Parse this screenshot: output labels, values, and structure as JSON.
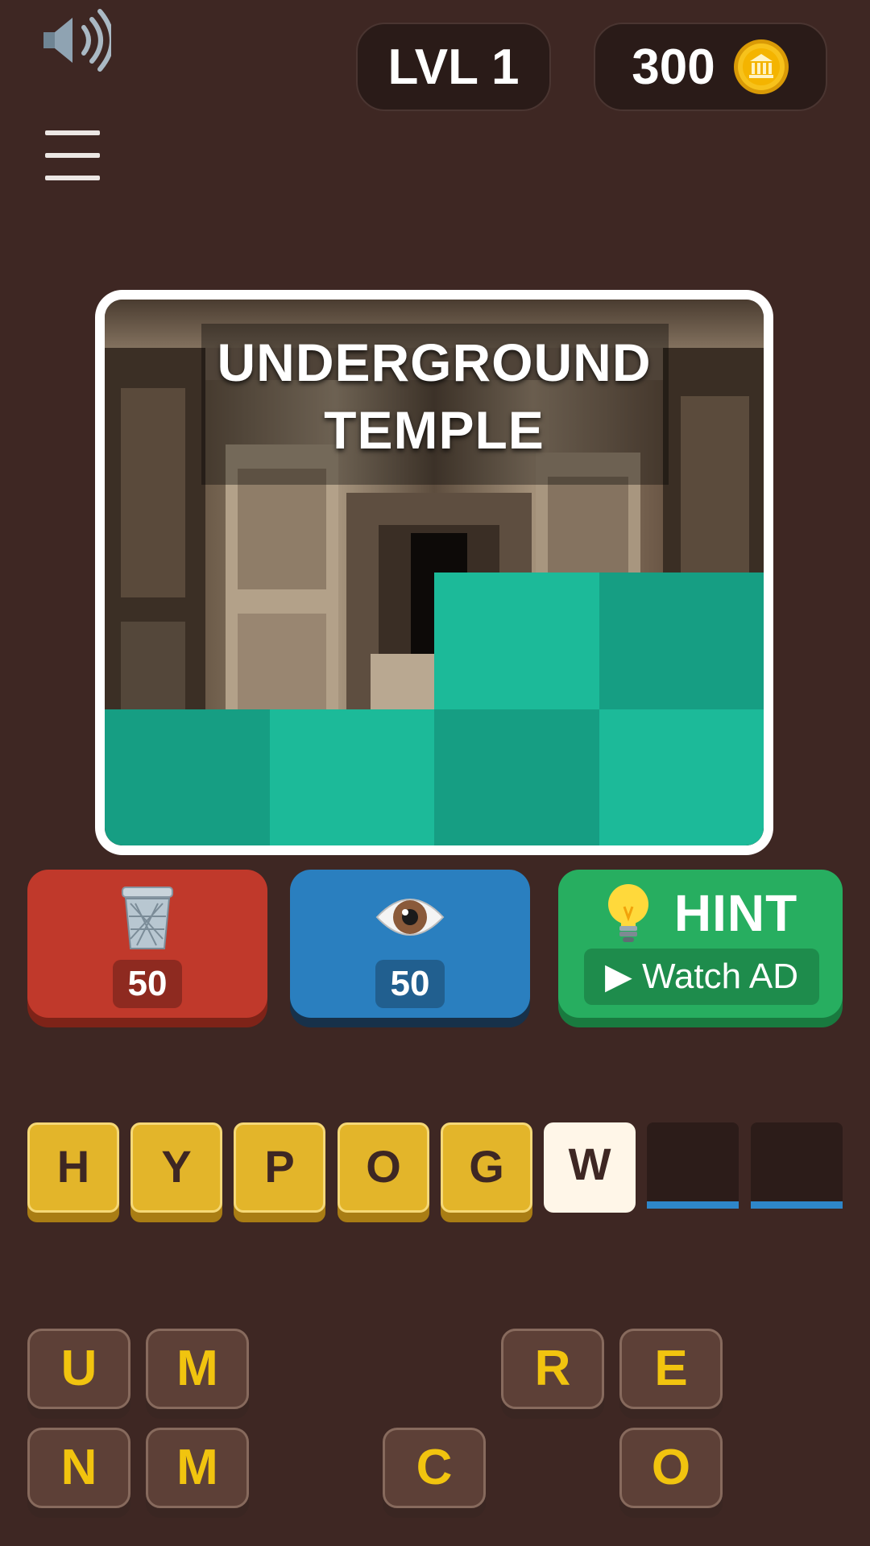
{
  "header": {
    "sound_icon": "speaker-icon",
    "menu_icon": "hamburger-menu-icon",
    "level_label": "LVL 1",
    "coins": "300",
    "coin_icon": "coin-icon"
  },
  "puzzle": {
    "caption_line1": "UNDERGROUND",
    "caption_line2": "TEMPLE",
    "covered_tiles": 6,
    "total_tiles": 12,
    "tile_colors": {
      "light": "#1cba99",
      "dark": "#169e83"
    }
  },
  "powerups": {
    "delete": {
      "icon": "trash-can-icon",
      "cost": "50",
      "color": "#c0392b"
    },
    "reveal": {
      "icon": "eye-icon",
      "cost": "50",
      "color": "#2a7fbf"
    },
    "hint": {
      "icon": "light-bulb-icon",
      "label": "HINT",
      "watch_ad": "▶ Watch AD",
      "color": "#27ae60"
    }
  },
  "answer": {
    "slots": [
      "H",
      "Y",
      "P",
      "O",
      "G",
      "W",
      "",
      ""
    ]
  },
  "letter_bank": {
    "row1": [
      "U",
      "M",
      "",
      "",
      "R",
      "E"
    ],
    "row2": [
      "N",
      "M",
      "",
      "C",
      "",
      "O"
    ]
  }
}
